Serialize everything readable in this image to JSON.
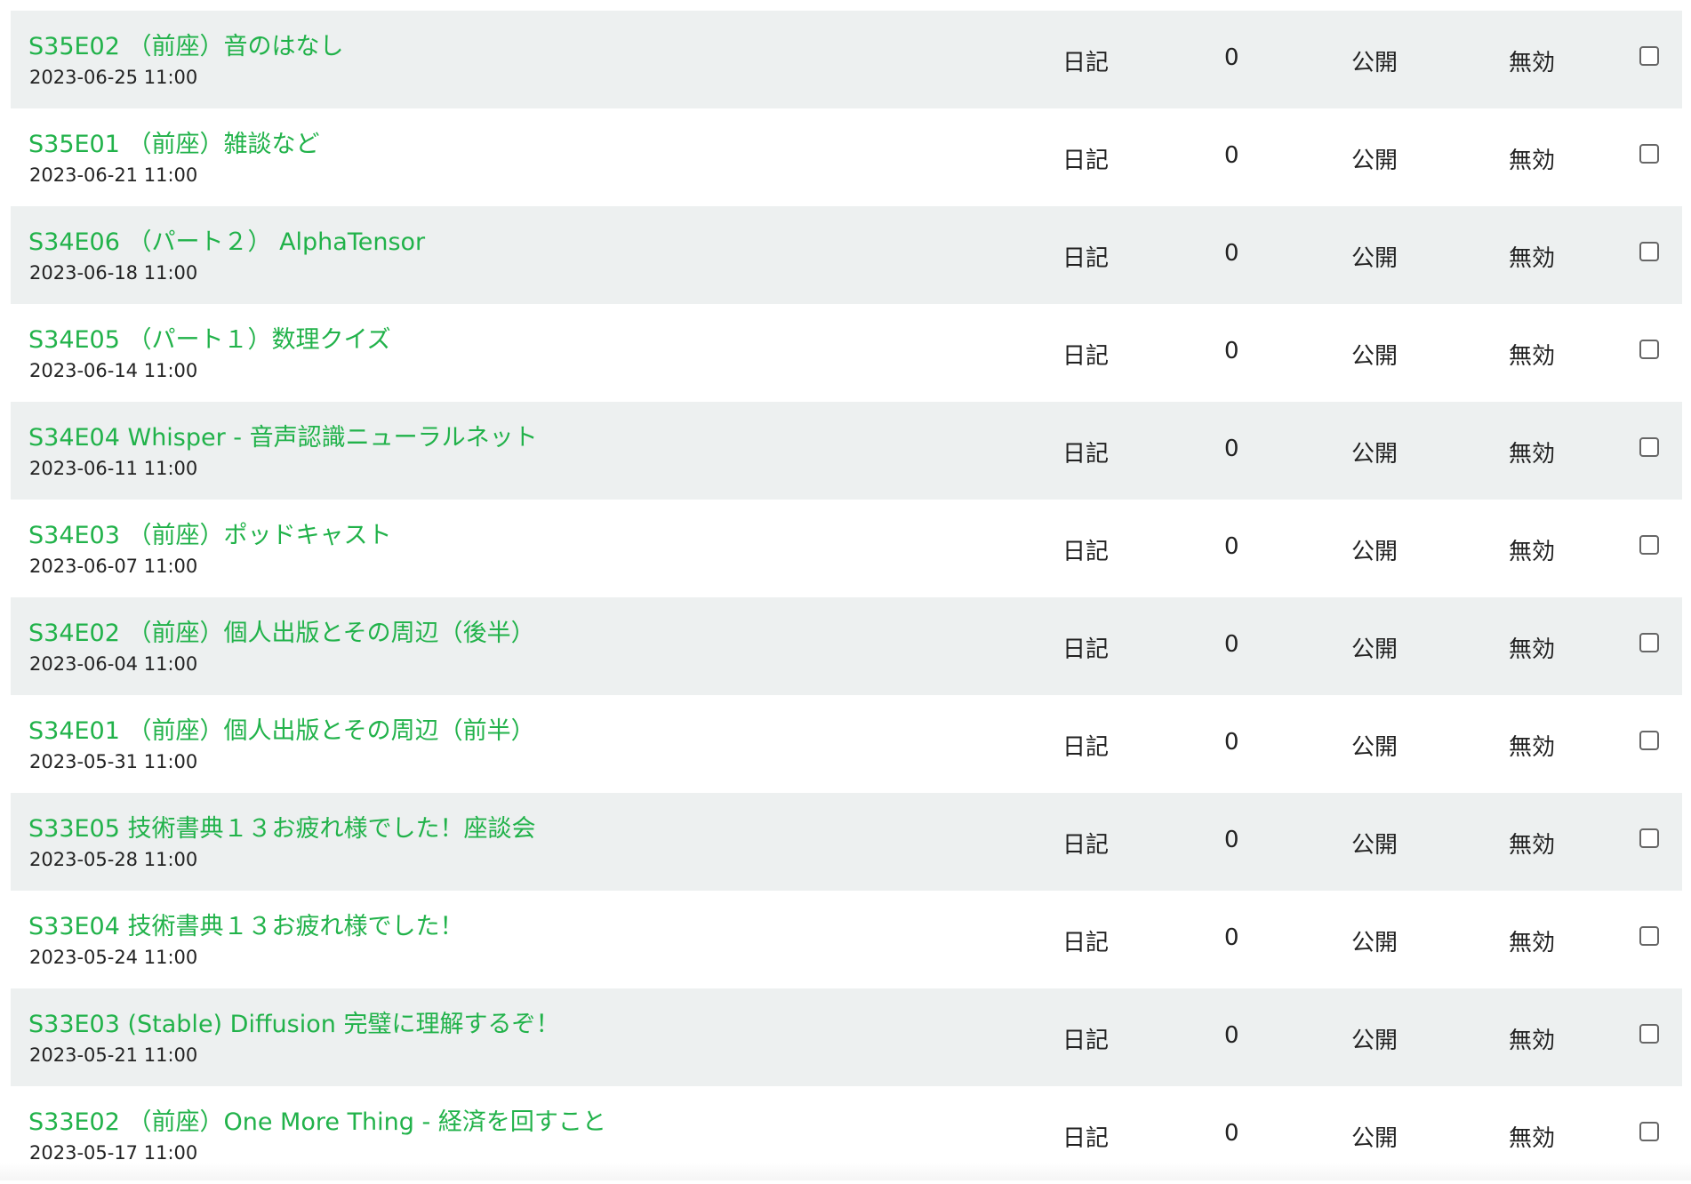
{
  "rows": [
    {
      "title": "S35E02 （前座）音のはなし",
      "date": "2023-06-25 11:00",
      "category": "日記",
      "count": "0",
      "visibility": "公開",
      "status": "無効"
    },
    {
      "title": "S35E01 （前座）雑談など",
      "date": "2023-06-21 11:00",
      "category": "日記",
      "count": "0",
      "visibility": "公開",
      "status": "無効"
    },
    {
      "title": "S34E06 （パート２） AlphaTensor",
      "date": "2023-06-18 11:00",
      "category": "日記",
      "count": "0",
      "visibility": "公開",
      "status": "無効"
    },
    {
      "title": "S34E05 （パート１）数理クイズ",
      "date": "2023-06-14 11:00",
      "category": "日記",
      "count": "0",
      "visibility": "公開",
      "status": "無効"
    },
    {
      "title": "S34E04 Whisper - 音声認識ニューラルネット",
      "date": "2023-06-11 11:00",
      "category": "日記",
      "count": "0",
      "visibility": "公開",
      "status": "無効"
    },
    {
      "title": "S34E03 （前座）ポッドキャスト",
      "date": "2023-06-07 11:00",
      "category": "日記",
      "count": "0",
      "visibility": "公開",
      "status": "無効"
    },
    {
      "title": "S34E02 （前座）個人出版とその周辺（後半）",
      "date": "2023-06-04 11:00",
      "category": "日記",
      "count": "0",
      "visibility": "公開",
      "status": "無効"
    },
    {
      "title": "S34E01 （前座）個人出版とその周辺（前半）",
      "date": "2023-05-31 11:00",
      "category": "日記",
      "count": "0",
      "visibility": "公開",
      "status": "無効"
    },
    {
      "title": "S33E05 技術書典１３お疲れ様でした！座談会",
      "date": "2023-05-28 11:00",
      "category": "日記",
      "count": "0",
      "visibility": "公開",
      "status": "無効"
    },
    {
      "title": "S33E04 技術書典１３お疲れ様でした！",
      "date": "2023-05-24 11:00",
      "category": "日記",
      "count": "0",
      "visibility": "公開",
      "status": "無効"
    },
    {
      "title": "S33E03 (Stable) Diffusion 完璧に理解するぞ！",
      "date": "2023-05-21 11:00",
      "category": "日記",
      "count": "0",
      "visibility": "公開",
      "status": "無効"
    },
    {
      "title": "S33E02 （前座）One More Thing - 経済を回すこと",
      "date": "2023-05-17 11:00",
      "category": "日記",
      "count": "0",
      "visibility": "公開",
      "status": "無効"
    }
  ],
  "colors": {
    "title_link": "#21b24a",
    "row_alt_bg": "#edf0f0",
    "text": "#222222"
  }
}
